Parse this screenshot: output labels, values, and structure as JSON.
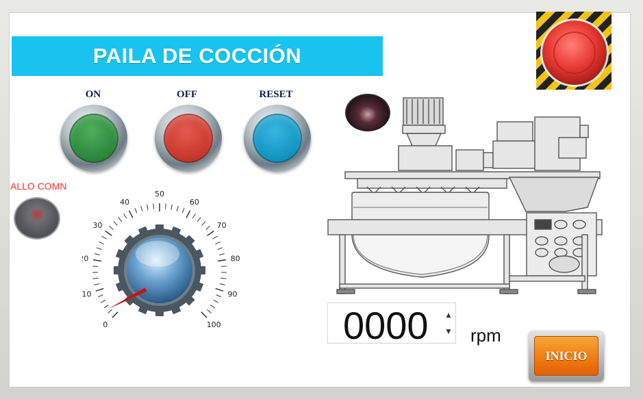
{
  "title": "PAILA DE COCCIÓN",
  "buttons": {
    "on": {
      "label": "ON",
      "color": "#2e8b3e"
    },
    "off": {
      "label": "OFF",
      "color": "#cc3a2e"
    },
    "reset": {
      "label": "RESET",
      "color": "#1597c4"
    }
  },
  "fault": {
    "label": "ALLO COMN",
    "lamp_color": "#cc2a2a"
  },
  "dial": {
    "ticks": [
      "0",
      "10",
      "20",
      "30",
      "40",
      "50",
      "60",
      "70",
      "80",
      "90",
      "100"
    ],
    "value": 3
  },
  "speed": {
    "value": "0000",
    "unit": "rpm"
  },
  "start_button": {
    "label": "INICIO",
    "color": "#f07d10"
  },
  "emergency_stop": {
    "color": "#e83a34"
  },
  "colors": {
    "title_bar": "#18c4ef",
    "label_text": "#0b1f4c",
    "fault_text": "#ff2b2b"
  }
}
